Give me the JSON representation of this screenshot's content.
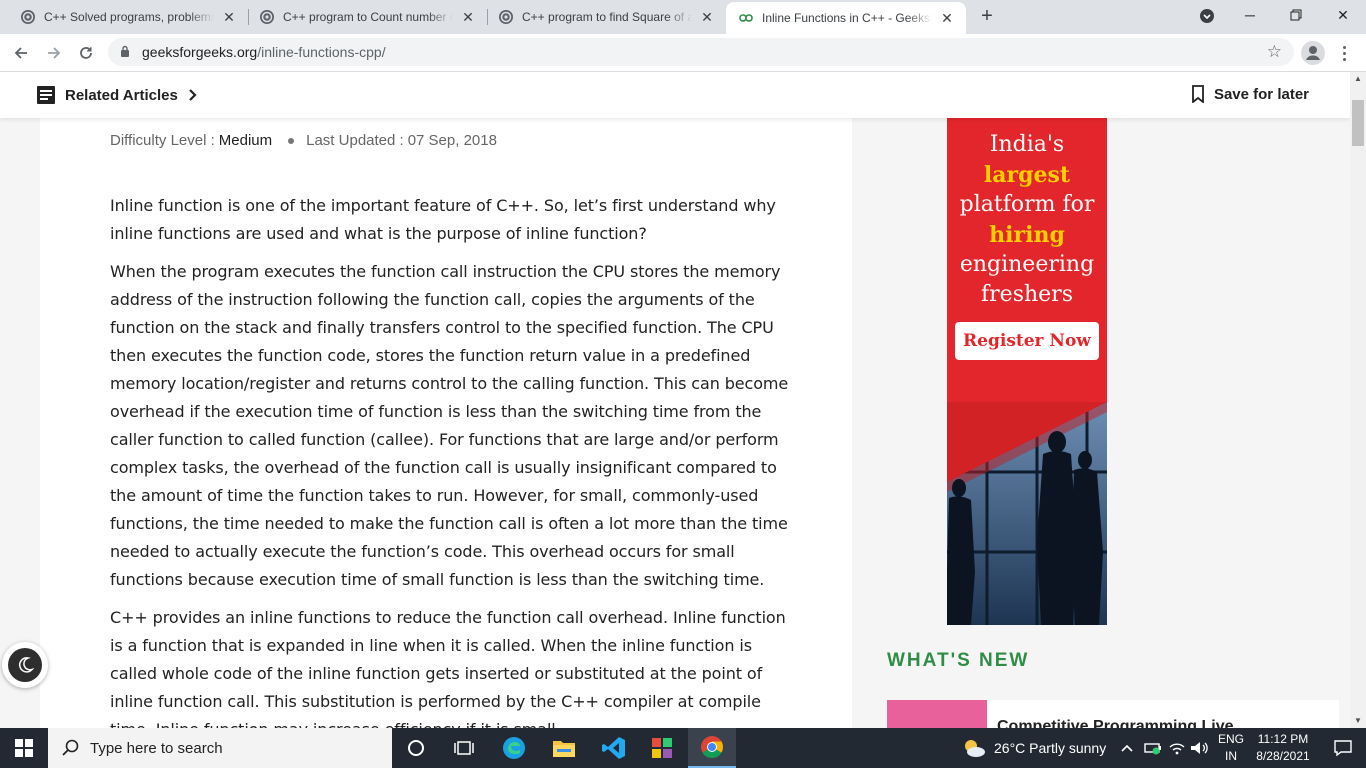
{
  "browser": {
    "tabs": [
      {
        "title": "C++ Solved programs, problems",
        "favicon": "globe-icon"
      },
      {
        "title": "C++ program to Count number of",
        "favicon": "globe-icon"
      },
      {
        "title": "C++ program to find Square of a",
        "favicon": "globe-icon"
      },
      {
        "title": "Inline Functions in C++ - GeeksforGeeks",
        "favicon": "gfg-logo-icon",
        "active": true
      }
    ],
    "url_domain": "geeksforgeeks.org",
    "url_path": "/inline-functions-cpp/"
  },
  "site_header": {
    "related_label": "Related Articles",
    "save_label": "Save for later"
  },
  "article": {
    "difficulty_label": "Difficulty Level :",
    "difficulty_value": "Medium",
    "updated_label": "Last Updated :",
    "updated_value": "07 Sep, 2018",
    "paragraphs": [
      "Inline function is one of the important feature of C++. So, let’s first understand why inline functions are used and what is the purpose of inline function?",
      "When the program executes the function call instruction the CPU stores the memory address of the instruction following the function call, copies the arguments of the function on the stack and finally transfers control to the specified function. The CPU then executes the function code, stores the function return value in a predefined memory location/register and returns control to the calling function. This can become overhead if the execution time of function is less than the switching time from the caller function to called function (callee). For functions that are large and/or perform complex tasks, the overhead of the function call is usually insignificant compared to the amount of time the function takes to run. However, for small, commonly-used functions, the time needed to make the function call is often a lot more than the time needed to actually execute the function’s code. This overhead occurs for small functions because execution time of small function is less than the switching time.",
      "C++ provides an inline functions to reduce the function call overhead. Inline function is a function that is expanded in line when it is called. When the inline function is called whole code of the inline function gets inserted or substituted at the point of inline function call. This substitution is performed by the C++ compiler at compile time. Inline function may increase efficiency if it is small."
    ]
  },
  "ad": {
    "line1": "India's",
    "line2": "largest",
    "line3": "platform for",
    "line4": "hiring",
    "line5": "engineering",
    "line6": "freshers",
    "cta": "Register Now",
    "bg_color": "#e3262b",
    "highlight_color": "#ffd000"
  },
  "sidebar": {
    "whats_new": "WHAT'S NEW",
    "first_item_title": "Competitive Programming Live"
  },
  "taskbar": {
    "search_placeholder": "Type here to search",
    "weather": "26°C  Partly sunny",
    "lang_top": "ENG",
    "lang_bottom": "IN",
    "time": "11:12 PM",
    "date": "8/28/2021"
  },
  "colors": {
    "gfg_green": "#2f8d46",
    "accent_blue": "#76b9ed"
  }
}
